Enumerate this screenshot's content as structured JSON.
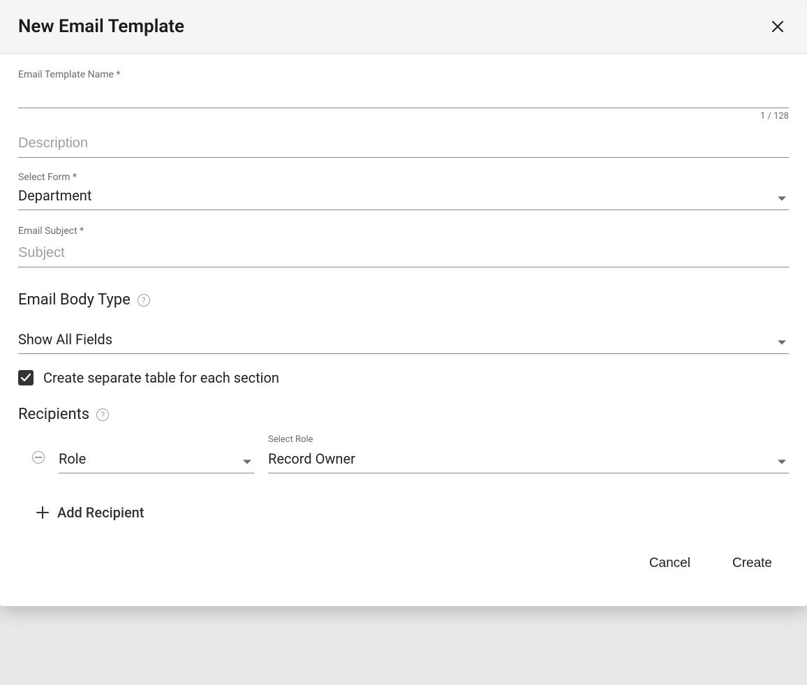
{
  "dialog": {
    "title": "New Email Template"
  },
  "fields": {
    "templateName": {
      "label": "Email Template Name *",
      "value": "",
      "counter": "1 / 128"
    },
    "description": {
      "placeholder": "Description",
      "value": ""
    },
    "selectForm": {
      "label": "Select Form *",
      "value": "Department"
    },
    "emailSubject": {
      "label": "Email Subject *",
      "placeholder": "Subject",
      "value": ""
    },
    "bodyType": {
      "heading": "Email Body Type",
      "value": "Show All Fields"
    },
    "separateTable": {
      "label": "Create separate table for each section",
      "checked": true
    }
  },
  "recipients": {
    "heading": "Recipients",
    "row": {
      "typeValue": "Role",
      "roleLabel": "Select Role",
      "roleValue": "Record Owner"
    },
    "addLabel": "Add Recipient"
  },
  "footer": {
    "cancel": "Cancel",
    "create": "Create"
  }
}
